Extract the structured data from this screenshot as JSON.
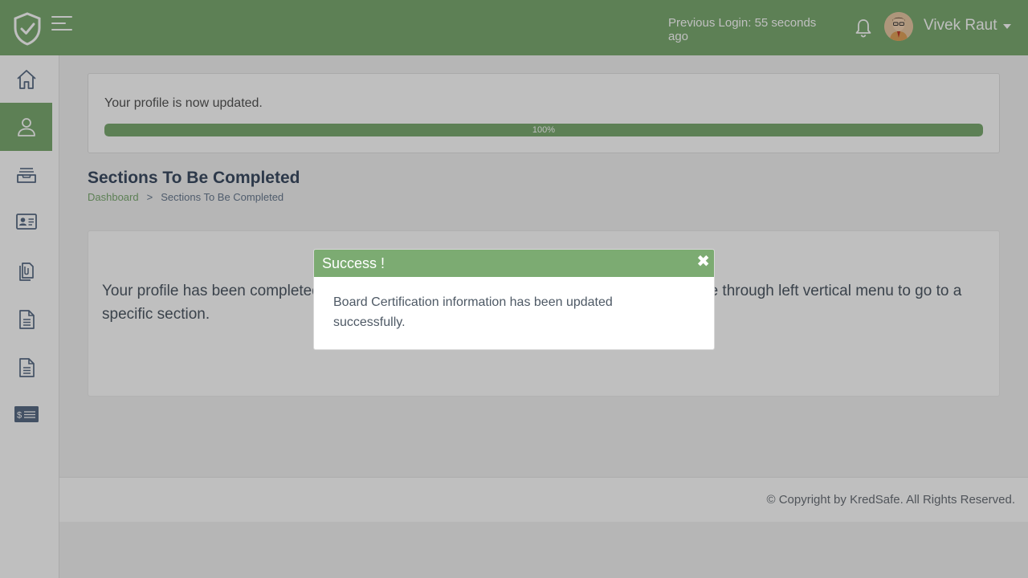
{
  "header": {
    "previous_login": "Previous Login: 55 seconds ago",
    "username": "Vivek Raut"
  },
  "sidebar": {
    "items": [
      {
        "icon": "home-icon"
      },
      {
        "icon": "user-icon",
        "active": true
      },
      {
        "icon": "inbox-icon"
      },
      {
        "icon": "id-card-icon"
      },
      {
        "icon": "documents-icon"
      },
      {
        "icon": "file-icon"
      },
      {
        "icon": "file-alt-icon"
      },
      {
        "icon": "billing-icon"
      }
    ]
  },
  "progress": {
    "message": "Your profile is now updated.",
    "percent_label": "100%",
    "value": 1.0
  },
  "page": {
    "title": "Sections To Be Completed",
    "breadcrumb": {
      "home": "Dashboard",
      "separator": ">",
      "current": "Sections To Be Completed"
    },
    "info": "Your profile has been completed. Please click on dashboard to view your profile or navigate through left vertical menu to go to a specific section."
  },
  "footer": {
    "copyright": "© Copyright by KredSafe. All Rights Reserved."
  },
  "modal": {
    "title": "Success !",
    "close": "✖",
    "message": "Board Certification information has been updated successfully."
  },
  "colors": {
    "accent": "#7cab72",
    "text": "#4e5965"
  }
}
